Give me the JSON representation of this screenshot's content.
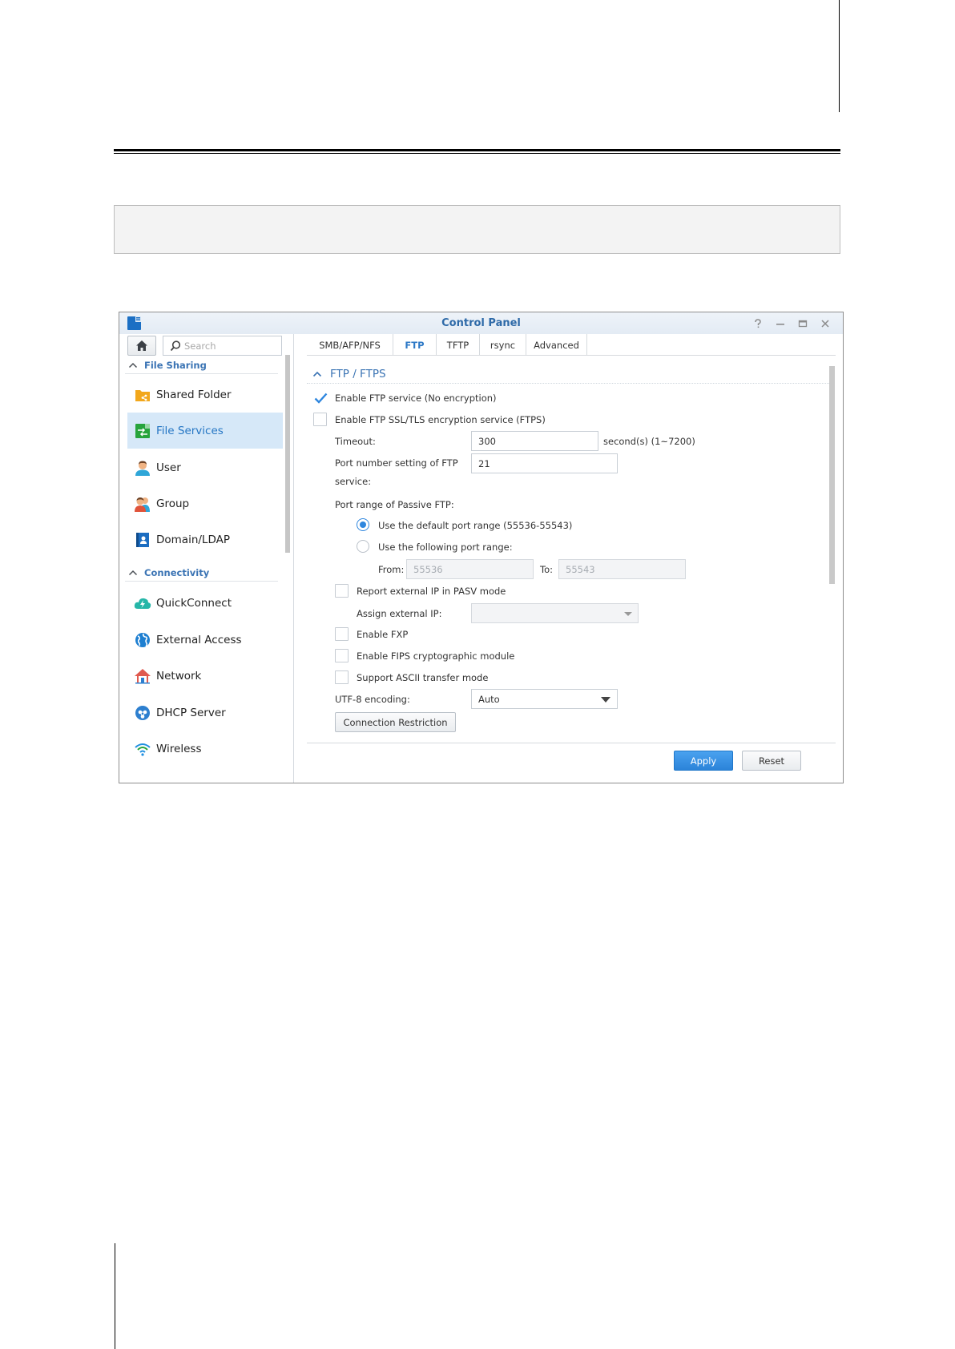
{
  "window": {
    "title": "Control Panel",
    "help_icon": "question-icon",
    "minimize_icon": "minimize-icon",
    "maximize_icon": "maximize-icon",
    "close_icon": "close-icon"
  },
  "sidebar": {
    "search_placeholder": "Search",
    "sections": [
      {
        "label": "File Sharing"
      },
      {
        "label": "Connectivity"
      }
    ],
    "items": [
      {
        "label": "Shared Folder",
        "icon": "shared-folder-icon",
        "color": "#f2a71b"
      },
      {
        "label": "File Services",
        "icon": "file-services-icon",
        "color": "#27a43c",
        "active": true
      },
      {
        "label": "User",
        "icon": "user-icon",
        "color": "#e9a06a"
      },
      {
        "label": "Group",
        "icon": "group-icon",
        "color": "#d9613b"
      },
      {
        "label": "Domain/LDAP",
        "icon": "domain-ldap-icon",
        "color": "#2173c4"
      },
      {
        "label": "QuickConnect",
        "icon": "quickconnect-icon",
        "color": "#26b6a8"
      },
      {
        "label": "External Access",
        "icon": "external-access-icon",
        "color": "#1e7fd1"
      },
      {
        "label": "Network",
        "icon": "network-icon",
        "color": "#e05a4f"
      },
      {
        "label": "DHCP Server",
        "icon": "dhcp-server-icon",
        "color": "#2d7fcf"
      },
      {
        "label": "Wireless",
        "icon": "wireless-icon",
        "color": "#1f8fe0"
      }
    ]
  },
  "tabs": [
    {
      "label": "SMB/AFP/NFS"
    },
    {
      "label": "FTP",
      "active": true
    },
    {
      "label": "TFTP"
    },
    {
      "label": "rsync"
    },
    {
      "label": "Advanced"
    }
  ],
  "ftp": {
    "section_title": "FTP / FTPS",
    "enable_ftp": {
      "label": "Enable FTP service (No encryption)",
      "checked": true
    },
    "enable_ftps": {
      "label": "Enable FTP SSL/TLS encryption service (FTPS)",
      "checked": false
    },
    "timeout": {
      "label": "Timeout:",
      "value": "300",
      "suffix": "second(s) (1~7200)"
    },
    "port": {
      "label_line1": "Port number setting of FTP",
      "label_line2": "service:",
      "value": "21"
    },
    "passive_label": "Port range of Passive FTP:",
    "default_range": {
      "label": "Use the default port range (55536-55543)",
      "selected": true
    },
    "custom_range": {
      "label": "Use the following port range:",
      "selected": false
    },
    "from_label": "From:",
    "from_value": "55536",
    "to_label": "To:",
    "to_value": "55543",
    "report_ip": {
      "label": "Report external IP in PASV mode",
      "checked": false
    },
    "assign_ip_label": "Assign external IP:",
    "assign_ip_value": "",
    "enable_fxp": {
      "label": "Enable FXP",
      "checked": false
    },
    "enable_fips": {
      "label": "Enable FIPS cryptographic module",
      "checked": false
    },
    "ascii_mode": {
      "label": "Support ASCII transfer mode",
      "checked": false
    },
    "utf8": {
      "label": "UTF-8 encoding:",
      "value": "Auto"
    },
    "connection_restriction_label": "Connection Restriction"
  },
  "footer": {
    "apply_label": "Apply",
    "reset_label": "Reset"
  },
  "colors": {
    "accent": "#2c78c6",
    "primary_button": "#2b83d9",
    "active_item_bg": "#d6e8f8"
  }
}
